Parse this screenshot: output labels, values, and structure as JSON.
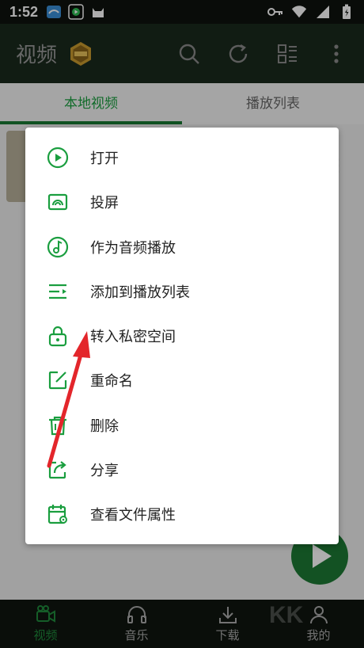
{
  "status_bar": {
    "time": "1:52"
  },
  "header": {
    "title": "视频"
  },
  "tabs": [
    {
      "label": "本地视频",
      "active": true
    },
    {
      "label": "播放列表",
      "active": false
    }
  ],
  "menu": {
    "items": [
      {
        "label": "打开",
        "icon": "play-circle-icon"
      },
      {
        "label": "投屏",
        "icon": "cast-icon"
      },
      {
        "label": "作为音频播放",
        "icon": "music-note-icon"
      },
      {
        "label": "添加到播放列表",
        "icon": "playlist-add-icon"
      },
      {
        "label": "转入私密空间",
        "icon": "lock-icon"
      },
      {
        "label": "重命名",
        "icon": "edit-icon"
      },
      {
        "label": "删除",
        "icon": "trash-icon"
      },
      {
        "label": "分享",
        "icon": "share-icon"
      },
      {
        "label": "查看文件属性",
        "icon": "file-properties-icon"
      }
    ]
  },
  "bottom_nav": [
    {
      "label": "视频",
      "active": true
    },
    {
      "label": "音乐",
      "active": false
    },
    {
      "label": "下载",
      "active": false
    },
    {
      "label": "我的",
      "active": false
    }
  ],
  "watermark": "KK",
  "colors": {
    "accent": "#1a9e3f",
    "arrow": "#e3262b"
  }
}
